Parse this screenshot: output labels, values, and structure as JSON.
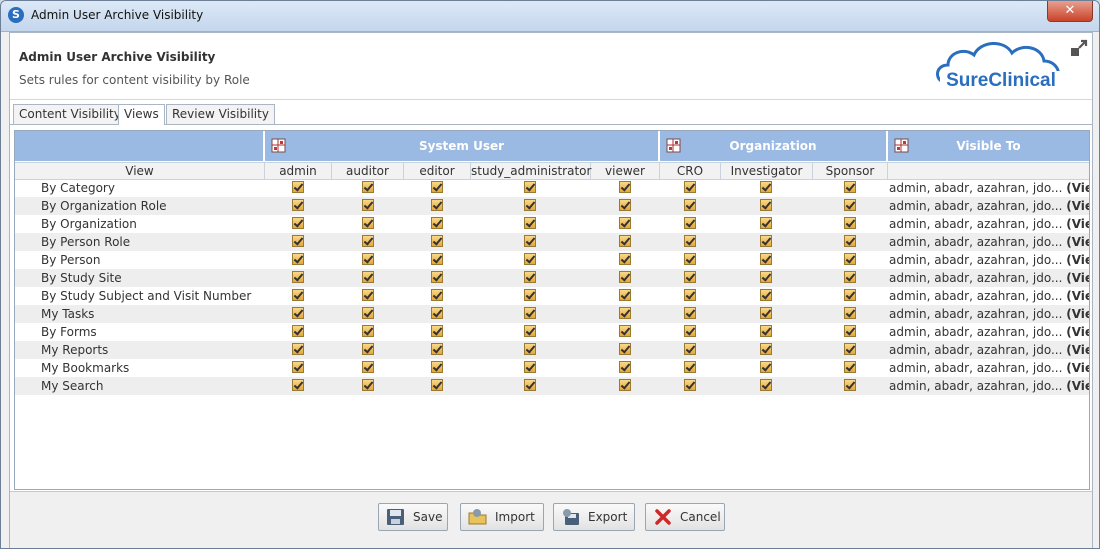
{
  "window": {
    "title": "Admin User Archive Visibility",
    "app_icon": "S"
  },
  "header": {
    "title": "Admin User Archive Visibility",
    "subtitle": "Sets rules for content visibility by Role",
    "logo_text": "SureClinical"
  },
  "tabs": [
    {
      "label": "Content Visibility",
      "active": false
    },
    {
      "label": "Views",
      "active": true
    },
    {
      "label": "Review Visibility",
      "active": false
    }
  ],
  "groups": {
    "system_user": "System User",
    "organization": "Organization",
    "visible_to": "Visible To"
  },
  "columns": {
    "view": "View",
    "system_user": [
      "admin",
      "auditor",
      "editor",
      "study_administrator",
      "viewer"
    ],
    "organization": [
      "CRO",
      "Investigator",
      "Sponsor"
    ]
  },
  "rows": [
    {
      "name": "By Category",
      "visible_to": "admin, abadr, azahran, jdo...",
      "view_link": "(View)"
    },
    {
      "name": "By Organization Role",
      "visible_to": "admin, abadr, azahran, jdo...",
      "view_link": "(View)"
    },
    {
      "name": "By Organization",
      "visible_to": "admin, abadr, azahran, jdo...",
      "view_link": "(View)"
    },
    {
      "name": "By Person Role",
      "visible_to": "admin, abadr, azahran, jdo...",
      "view_link": "(View)"
    },
    {
      "name": "By Person",
      "visible_to": "admin, abadr, azahran, jdo...",
      "view_link": "(View)"
    },
    {
      "name": "By Study Site",
      "visible_to": "admin, abadr, azahran, jdo...",
      "view_link": "(View)"
    },
    {
      "name": "By Study Subject and Visit Number",
      "visible_to": "admin, abadr, azahran, jdo...",
      "view_link": "(View)"
    },
    {
      "name": "My Tasks",
      "visible_to": "admin, abadr, azahran, jdo...",
      "view_link": "(View)"
    },
    {
      "name": "By Forms",
      "visible_to": "admin, abadr, azahran, jdo...",
      "view_link": "(View)"
    },
    {
      "name": "My Reports",
      "visible_to": "admin, abadr, azahran, jdo...",
      "view_link": "(View)"
    },
    {
      "name": "My Bookmarks",
      "visible_to": "admin, abadr, azahran, jdo...",
      "view_link": "(View)"
    },
    {
      "name": "My Search",
      "visible_to": "admin, abadr, azahran, jdo...",
      "view_link": "(View)"
    }
  ],
  "checkbox_state": "checked",
  "buttons": {
    "save": "Save",
    "import": "Import",
    "export": "Export",
    "cancel": "Cancel"
  },
  "colors": {
    "group_header": "#9ab9e3",
    "checkbox": "#e6a63a",
    "logo_blue": "#2a6ebf"
  }
}
